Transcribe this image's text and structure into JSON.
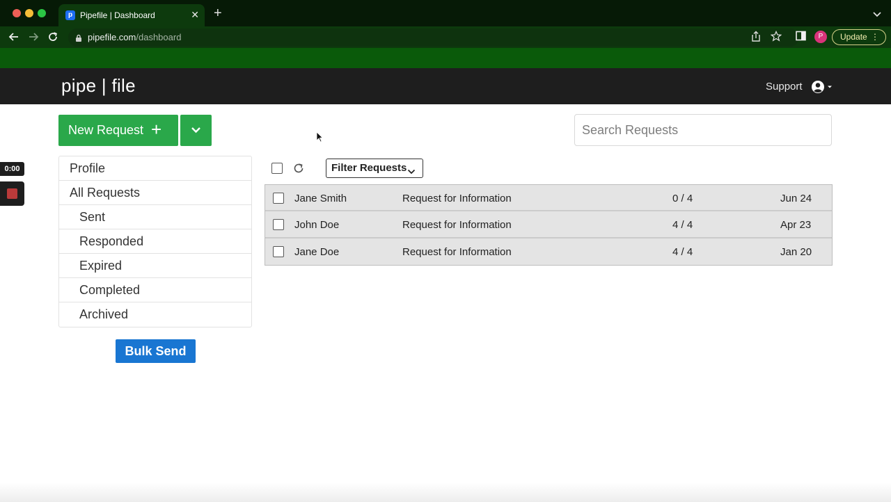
{
  "browser": {
    "tab_title": "Pipefile | Dashboard",
    "tab_favicon_letter": "p",
    "url_host": "pipefile.com",
    "url_path": "/dashboard",
    "profile_initial": "P",
    "update_label": "Update"
  },
  "app": {
    "brand": "pipe | file",
    "support_label": "Support"
  },
  "actions": {
    "new_request_label": "New Request",
    "search_placeholder": "Search Requests",
    "bulk_send_label": "Bulk Send",
    "filter_label": "Filter Requests"
  },
  "sidebar": {
    "items": [
      {
        "label": "Profile"
      },
      {
        "label": "All Requests"
      },
      {
        "label": "Sent"
      },
      {
        "label": "Responded"
      },
      {
        "label": "Expired"
      },
      {
        "label": "Completed"
      },
      {
        "label": "Archived"
      }
    ]
  },
  "requests": [
    {
      "name": "Jane Smith",
      "type": "Request for Information",
      "progress": "0 / 4",
      "date": "Jun 24"
    },
    {
      "name": "John Doe",
      "type": "Request for Information",
      "progress": "4 / 4",
      "date": "Apr 23"
    },
    {
      "name": "Jane Doe",
      "type": "Request for Information",
      "progress": "4 / 4",
      "date": "Jan 20"
    }
  ],
  "recorder": {
    "time": "0:00"
  },
  "colors": {
    "primary_green": "#2aa84a",
    "bulk_blue": "#1976d2",
    "header_dark": "#1e1e1e"
  }
}
